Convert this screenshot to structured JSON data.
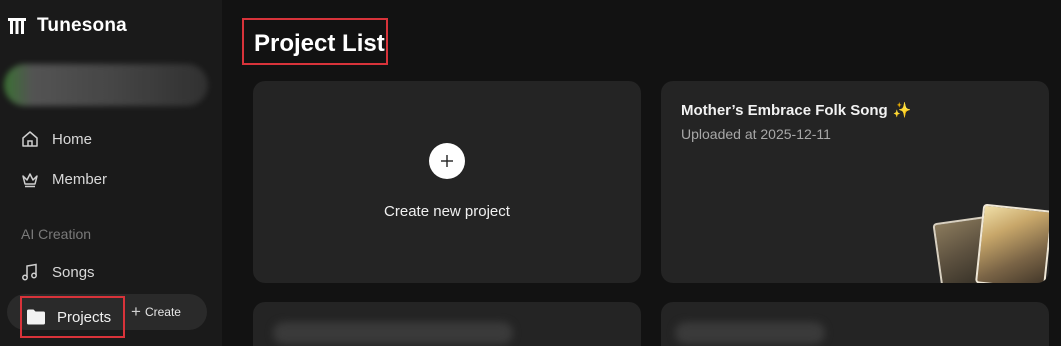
{
  "sidebar": {
    "brand": "Tunesona",
    "nav": {
      "home": "Home",
      "member": "Member"
    },
    "section_label": "AI Creation",
    "songs": "Songs",
    "projects": "Projects",
    "create": "Create"
  },
  "main": {
    "title": "Project List",
    "create_card_label": "Create new project",
    "projects": [
      {
        "title": "Mother’s Embrace Folk Song",
        "uploaded": "Uploaded at 2025-12-11"
      }
    ]
  },
  "colors": {
    "background": "#121212",
    "sidebar": "#1a1a1a",
    "card": "#242424",
    "highlight_box": "#d8333a"
  }
}
